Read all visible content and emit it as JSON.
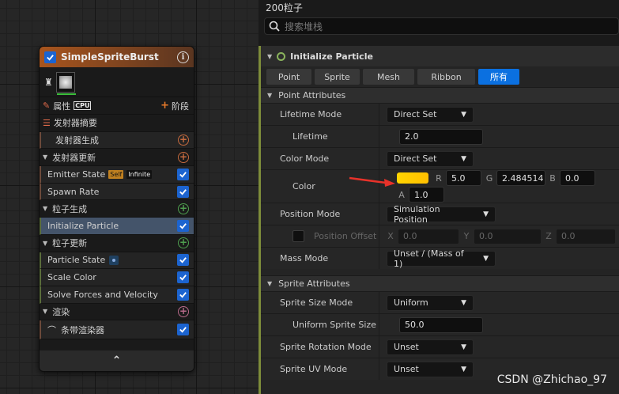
{
  "node": {
    "title": "SimpleSpriteBurst",
    "info_glyph": "i",
    "properties_label": "属性",
    "sim_target": "CPU",
    "stage_label": "阶段",
    "rows": [
      {
        "label": "发射器摘要"
      },
      {
        "label": "发射器生成"
      },
      {
        "label": "发射器更新"
      },
      {
        "label": "Emitter State",
        "badge1": "Self",
        "badge2": "Infinite"
      },
      {
        "label": "Spawn Rate"
      },
      {
        "label": "粒子生成"
      },
      {
        "label": "Initialize Particle"
      },
      {
        "label": "粒子更新"
      },
      {
        "label": "Particle State"
      },
      {
        "label": "Scale Color"
      },
      {
        "label": "Solve Forces and Velocity"
      },
      {
        "label": "渲染"
      },
      {
        "label": "条带渲染器"
      }
    ],
    "footer_glyph": "⌃"
  },
  "panel": {
    "title": "200粒子",
    "search_placeholder": "搜索堆栈",
    "module_title": "Initialize Particle",
    "filters": [
      "Point",
      "Sprite",
      "Mesh",
      "Ribbon",
      "所有"
    ],
    "point_attributes": "Point Attributes",
    "lifetime_mode_label": "Lifetime Mode",
    "lifetime_mode_value": "Direct Set",
    "lifetime_label": "Lifetime",
    "lifetime_value": "2.0",
    "color_mode_label": "Color Mode",
    "color_mode_value": "Direct Set",
    "color_label": "Color",
    "color_swatch": "#ffd400",
    "color_r_label": "R",
    "color_r": "5.0",
    "color_g_label": "G",
    "color_g": "2.484514",
    "color_b_label": "B",
    "color_b": "0.0",
    "color_a_label": "A",
    "color_a": "1.0",
    "position_mode_label": "Position Mode",
    "position_mode_value": "Simulation Position",
    "position_offset_label": "Position Offset",
    "pos_x_label": "X",
    "pos_x": "0.0",
    "pos_y_label": "Y",
    "pos_y": "0.0",
    "pos_z_label": "Z",
    "pos_z": "0.0",
    "mass_mode_label": "Mass Mode",
    "mass_mode_value": "Unset / (Mass of 1)",
    "sprite_attributes": "Sprite Attributes",
    "sprite_size_mode_label": "Sprite Size Mode",
    "sprite_size_mode_value": "Uniform",
    "uniform_sprite_size_label": "Uniform Sprite Size",
    "uniform_sprite_size_value": "50.0",
    "sprite_rotation_mode_label": "Sprite Rotation Mode",
    "sprite_rotation_mode_value": "Unset",
    "sprite_uv_mode_label": "Sprite UV Mode",
    "sprite_uv_mode_value": "Unset"
  },
  "watermark": "CSDN @Zhichao_97",
  "colors": {
    "accent_blue": "#0b70e0",
    "annotation_arrow": "#e8322a",
    "module_accent": "#7d8c3a"
  }
}
